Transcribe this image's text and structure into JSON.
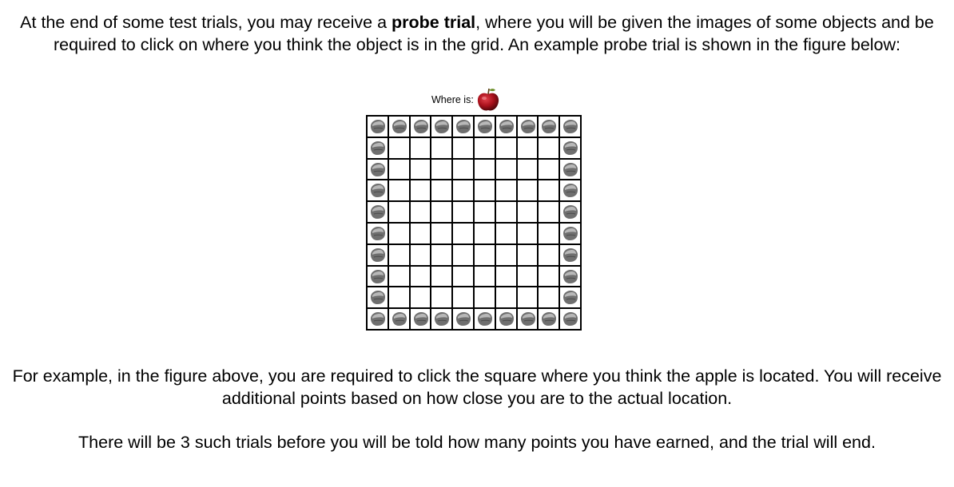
{
  "intro": {
    "before_bold": "At the end of some test trials, you may receive a ",
    "bold": "probe trial",
    "after_bold": ", where you will be given the images of some objects and be required to click on where you think the object is in the grid. An example probe trial is shown in the figure below:"
  },
  "probe": {
    "label": "Where is:",
    "object_icon": "apple-icon"
  },
  "grid": {
    "rows": 10,
    "cols": 10,
    "border_icon": "rock-icon"
  },
  "paragraphs": {
    "example": "For example, in the figure above, you are required to click the square where you think the apple is located. You will receive additional points based on how close you are to the actual location.",
    "trials": "There will be 3 such trials before you will be told how many points you have earned, and the trial will end."
  },
  "colors": {
    "apple_red": "#b0121c",
    "rock_gray": "#7a7a7a"
  }
}
